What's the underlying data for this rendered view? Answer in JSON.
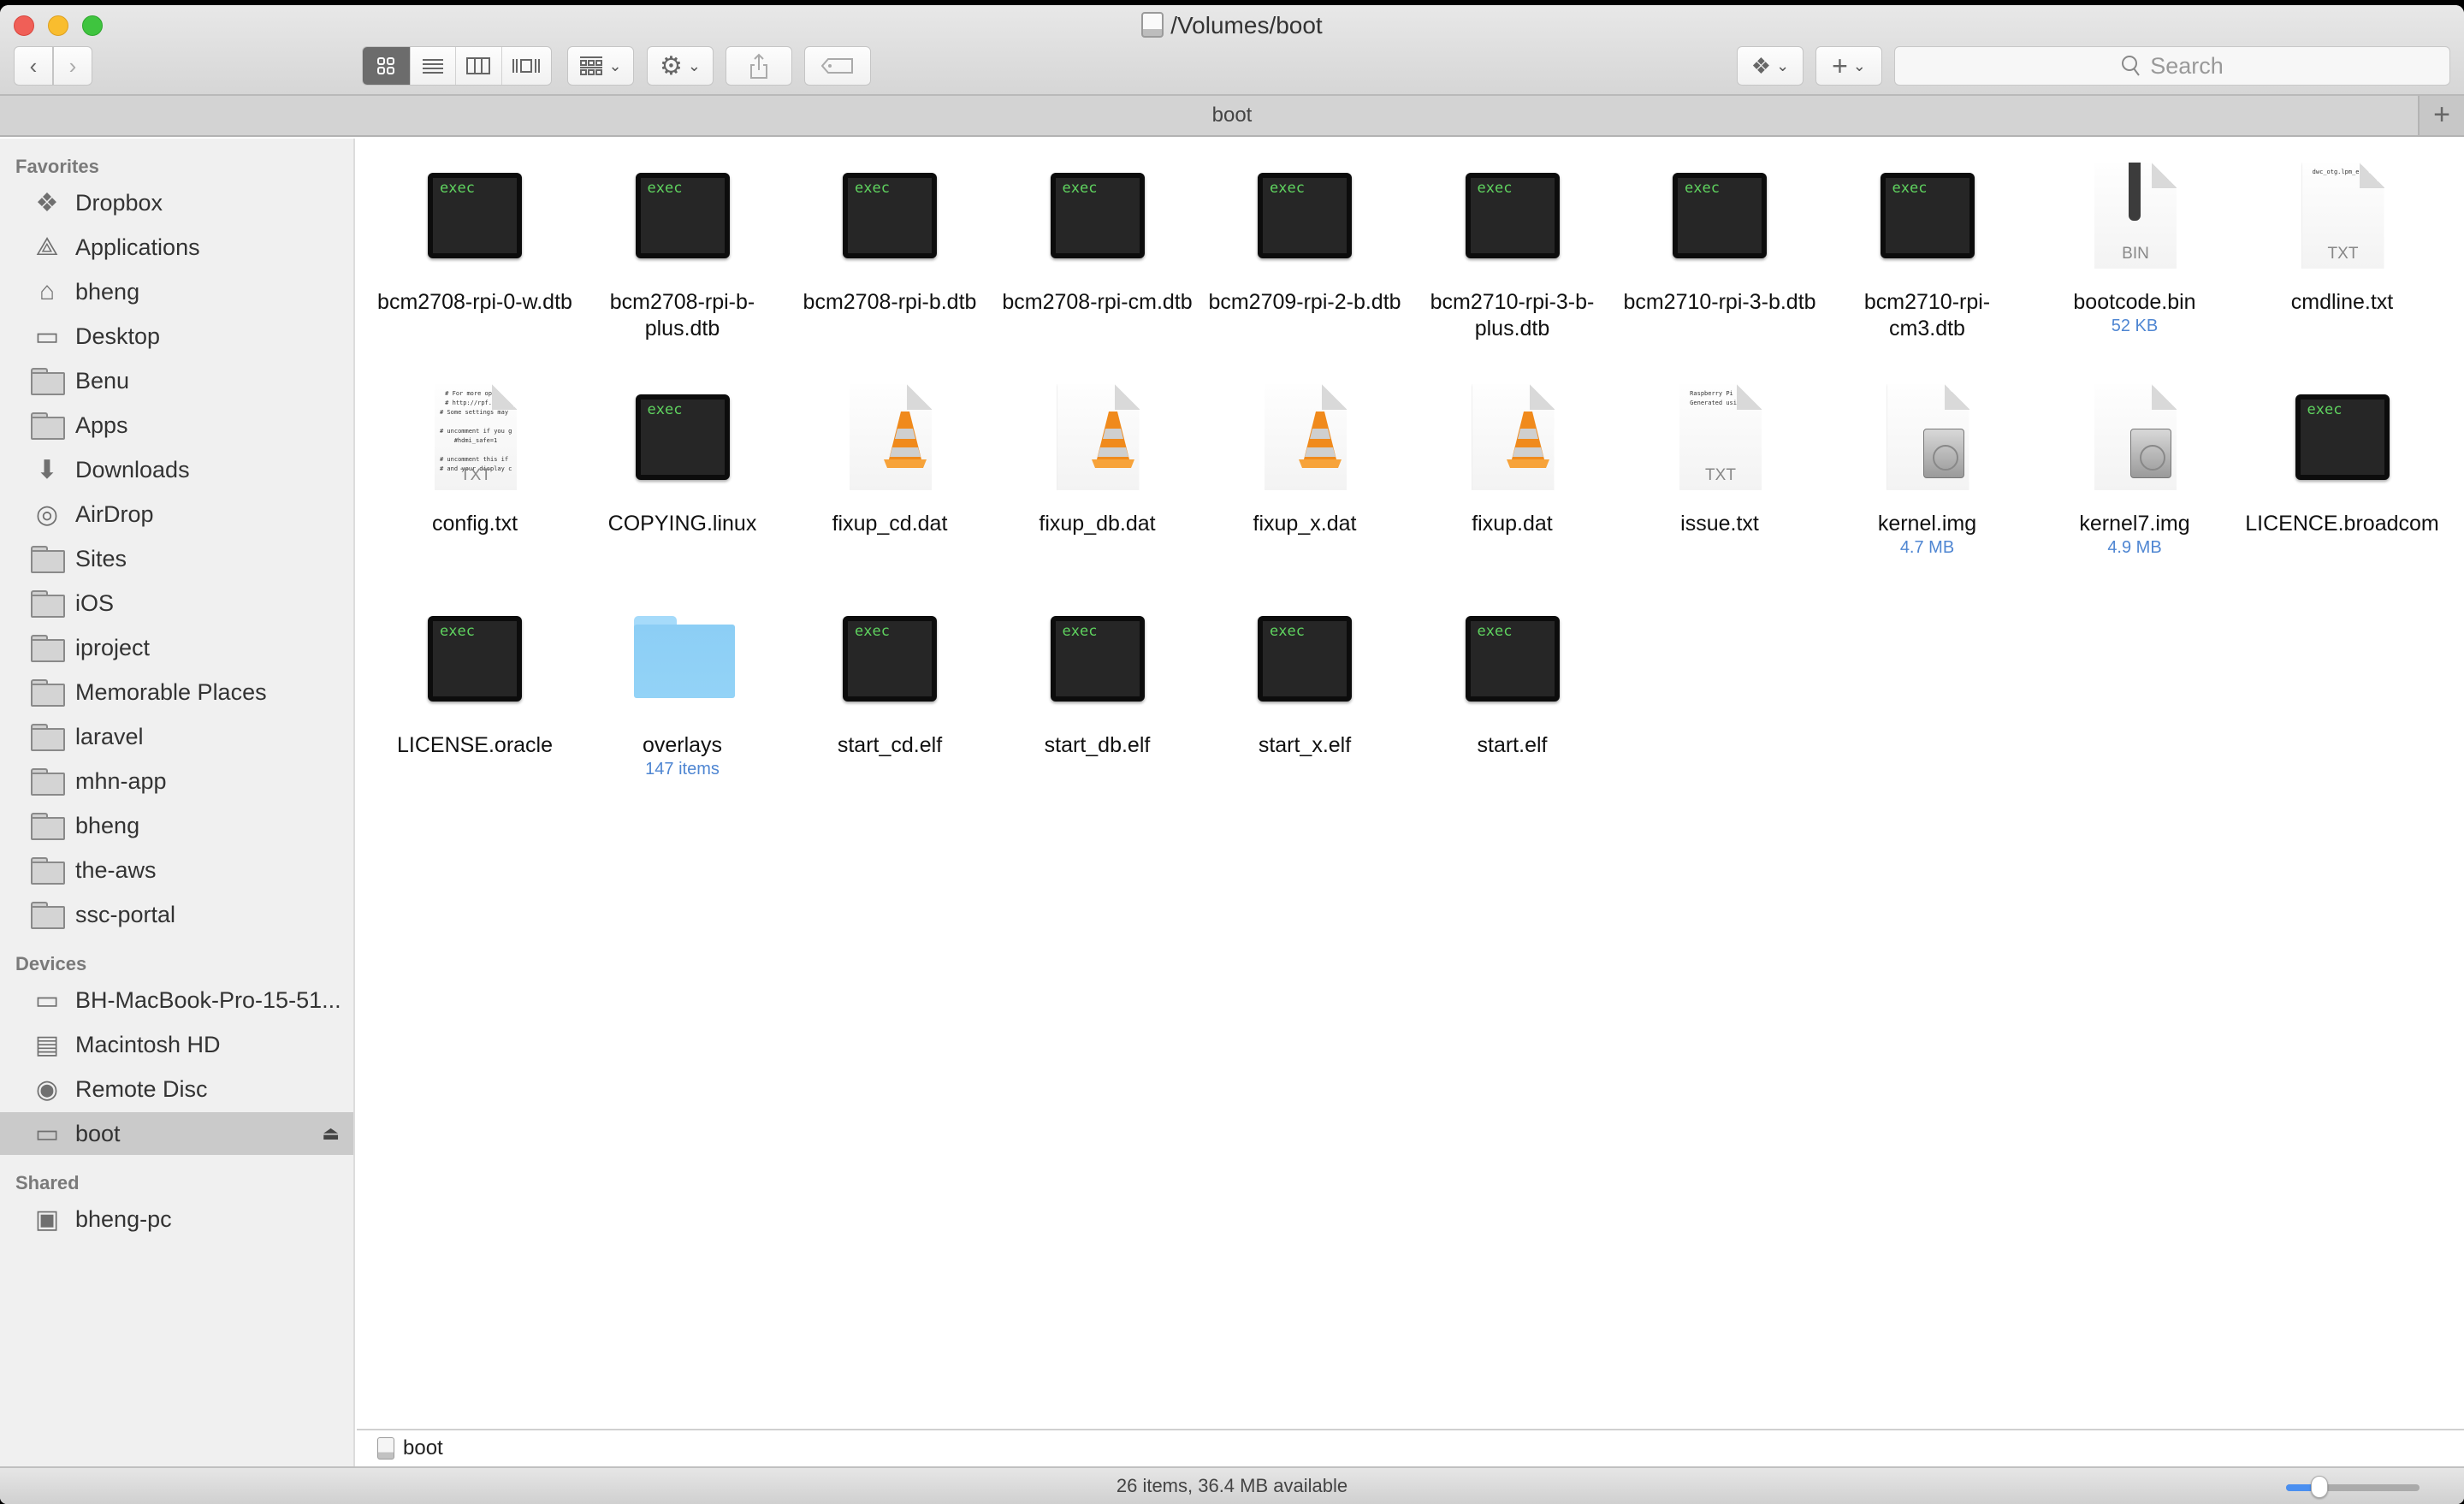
{
  "window": {
    "title": "/Volumes/boot",
    "tab_label": "boot"
  },
  "toolbar": {
    "back_label": "Back",
    "forward_label": "Forward",
    "view_modes": [
      "icon",
      "list",
      "column",
      "cover-flow"
    ],
    "active_view": "icon",
    "search_placeholder": "Search"
  },
  "sidebar": {
    "sections": [
      {
        "heading": "Favorites",
        "items": [
          {
            "label": "Dropbox",
            "icon": "dropbox-icon"
          },
          {
            "label": "Applications",
            "icon": "applications-icon"
          },
          {
            "label": "bheng",
            "icon": "home-icon"
          },
          {
            "label": "Desktop",
            "icon": "desktop-icon"
          },
          {
            "label": "Benu",
            "icon": "folder-icon"
          },
          {
            "label": "Apps",
            "icon": "folder-icon"
          },
          {
            "label": "Downloads",
            "icon": "downloads-icon"
          },
          {
            "label": "AirDrop",
            "icon": "airdrop-icon"
          },
          {
            "label": "Sites",
            "icon": "folder-icon"
          },
          {
            "label": "iOS",
            "icon": "folder-icon"
          },
          {
            "label": "iproject",
            "icon": "folder-icon"
          },
          {
            "label": "Memorable Places",
            "icon": "folder-icon"
          },
          {
            "label": "laravel",
            "icon": "folder-icon"
          },
          {
            "label": "mhn-app",
            "icon": "folder-icon"
          },
          {
            "label": "bheng",
            "icon": "folder-icon"
          },
          {
            "label": "the-aws",
            "icon": "folder-icon"
          },
          {
            "label": "ssc-portal",
            "icon": "folder-icon"
          }
        ]
      },
      {
        "heading": "Devices",
        "items": [
          {
            "label": "BH-MacBook-Pro-15-51...",
            "icon": "laptop-icon"
          },
          {
            "label": "Macintosh HD",
            "icon": "hard-drive-icon"
          },
          {
            "label": "Remote Disc",
            "icon": "disc-icon"
          },
          {
            "label": "boot",
            "icon": "external-drive-icon",
            "selected": true,
            "eject": "⏏"
          }
        ]
      },
      {
        "heading": "Shared",
        "items": [
          {
            "label": "bheng-pc",
            "icon": "pc-icon"
          }
        ]
      }
    ]
  },
  "files": [
    {
      "name": "bcm2708-rpi-0-w.dtb",
      "kind": "exec"
    },
    {
      "name": "bcm2708-rpi-b-plus.dtb",
      "kind": "exec"
    },
    {
      "name": "bcm2708-rpi-b.dtb",
      "kind": "exec"
    },
    {
      "name": "bcm2708-rpi-cm.dtb",
      "kind": "exec"
    },
    {
      "name": "bcm2709-rpi-2-b.dtb",
      "kind": "exec"
    },
    {
      "name": "bcm2710-rpi-3-b-plus.dtb",
      "kind": "exec"
    },
    {
      "name": "bcm2710-rpi-3-b.dtb",
      "kind": "exec"
    },
    {
      "name": "bcm2710-rpi-cm3.dtb",
      "kind": "exec"
    },
    {
      "name": "bootcode.bin",
      "kind": "bin",
      "ext": "BIN",
      "sub": "52 KB"
    },
    {
      "name": "cmdline.txt",
      "kind": "txt",
      "ext": "TXT",
      "preview": "dwc_otg.lpm_enabl"
    },
    {
      "name": "config.txt",
      "kind": "txt",
      "ext": "TXT",
      "preview": "# For more option\n# http://rpf.io/c\n# Some settings may im\n\n# uncomment if you get\n#hdmi_safe=1\n\n# uncomment this if you\n# and your display can"
    },
    {
      "name": "COPYING.linux",
      "kind": "exec"
    },
    {
      "name": "fixup_cd.dat",
      "kind": "vlc"
    },
    {
      "name": "fixup_db.dat",
      "kind": "vlc"
    },
    {
      "name": "fixup_x.dat",
      "kind": "vlc"
    },
    {
      "name": "fixup.dat",
      "kind": "vlc"
    },
    {
      "name": "issue.txt",
      "kind": "txt",
      "ext": "TXT",
      "preview": "Raspberry Pi refe\nGenerated using p"
    },
    {
      "name": "kernel.img",
      "kind": "img",
      "sub": "4.7 MB"
    },
    {
      "name": "kernel7.img",
      "kind": "img",
      "sub": "4.9 MB"
    },
    {
      "name": "LICENCE.broadcom",
      "kind": "exec"
    },
    {
      "name": "LICENSE.oracle",
      "kind": "exec"
    },
    {
      "name": "overlays",
      "kind": "folder",
      "sub": "147 items"
    },
    {
      "name": "start_cd.elf",
      "kind": "exec"
    },
    {
      "name": "start_db.elf",
      "kind": "exec"
    },
    {
      "name": "start_x.elf",
      "kind": "exec"
    },
    {
      "name": "start.elf",
      "kind": "exec"
    }
  ],
  "exec_badge": "exec",
  "pathbar": {
    "label": "boot"
  },
  "statusbar": {
    "text": "26 items, 36.4 MB available",
    "icon_size_fraction": 0.25
  },
  "colors": {
    "accent": "#4a8ff0",
    "size_label": "#4f86d2",
    "exec_text": "#5fd35f"
  }
}
